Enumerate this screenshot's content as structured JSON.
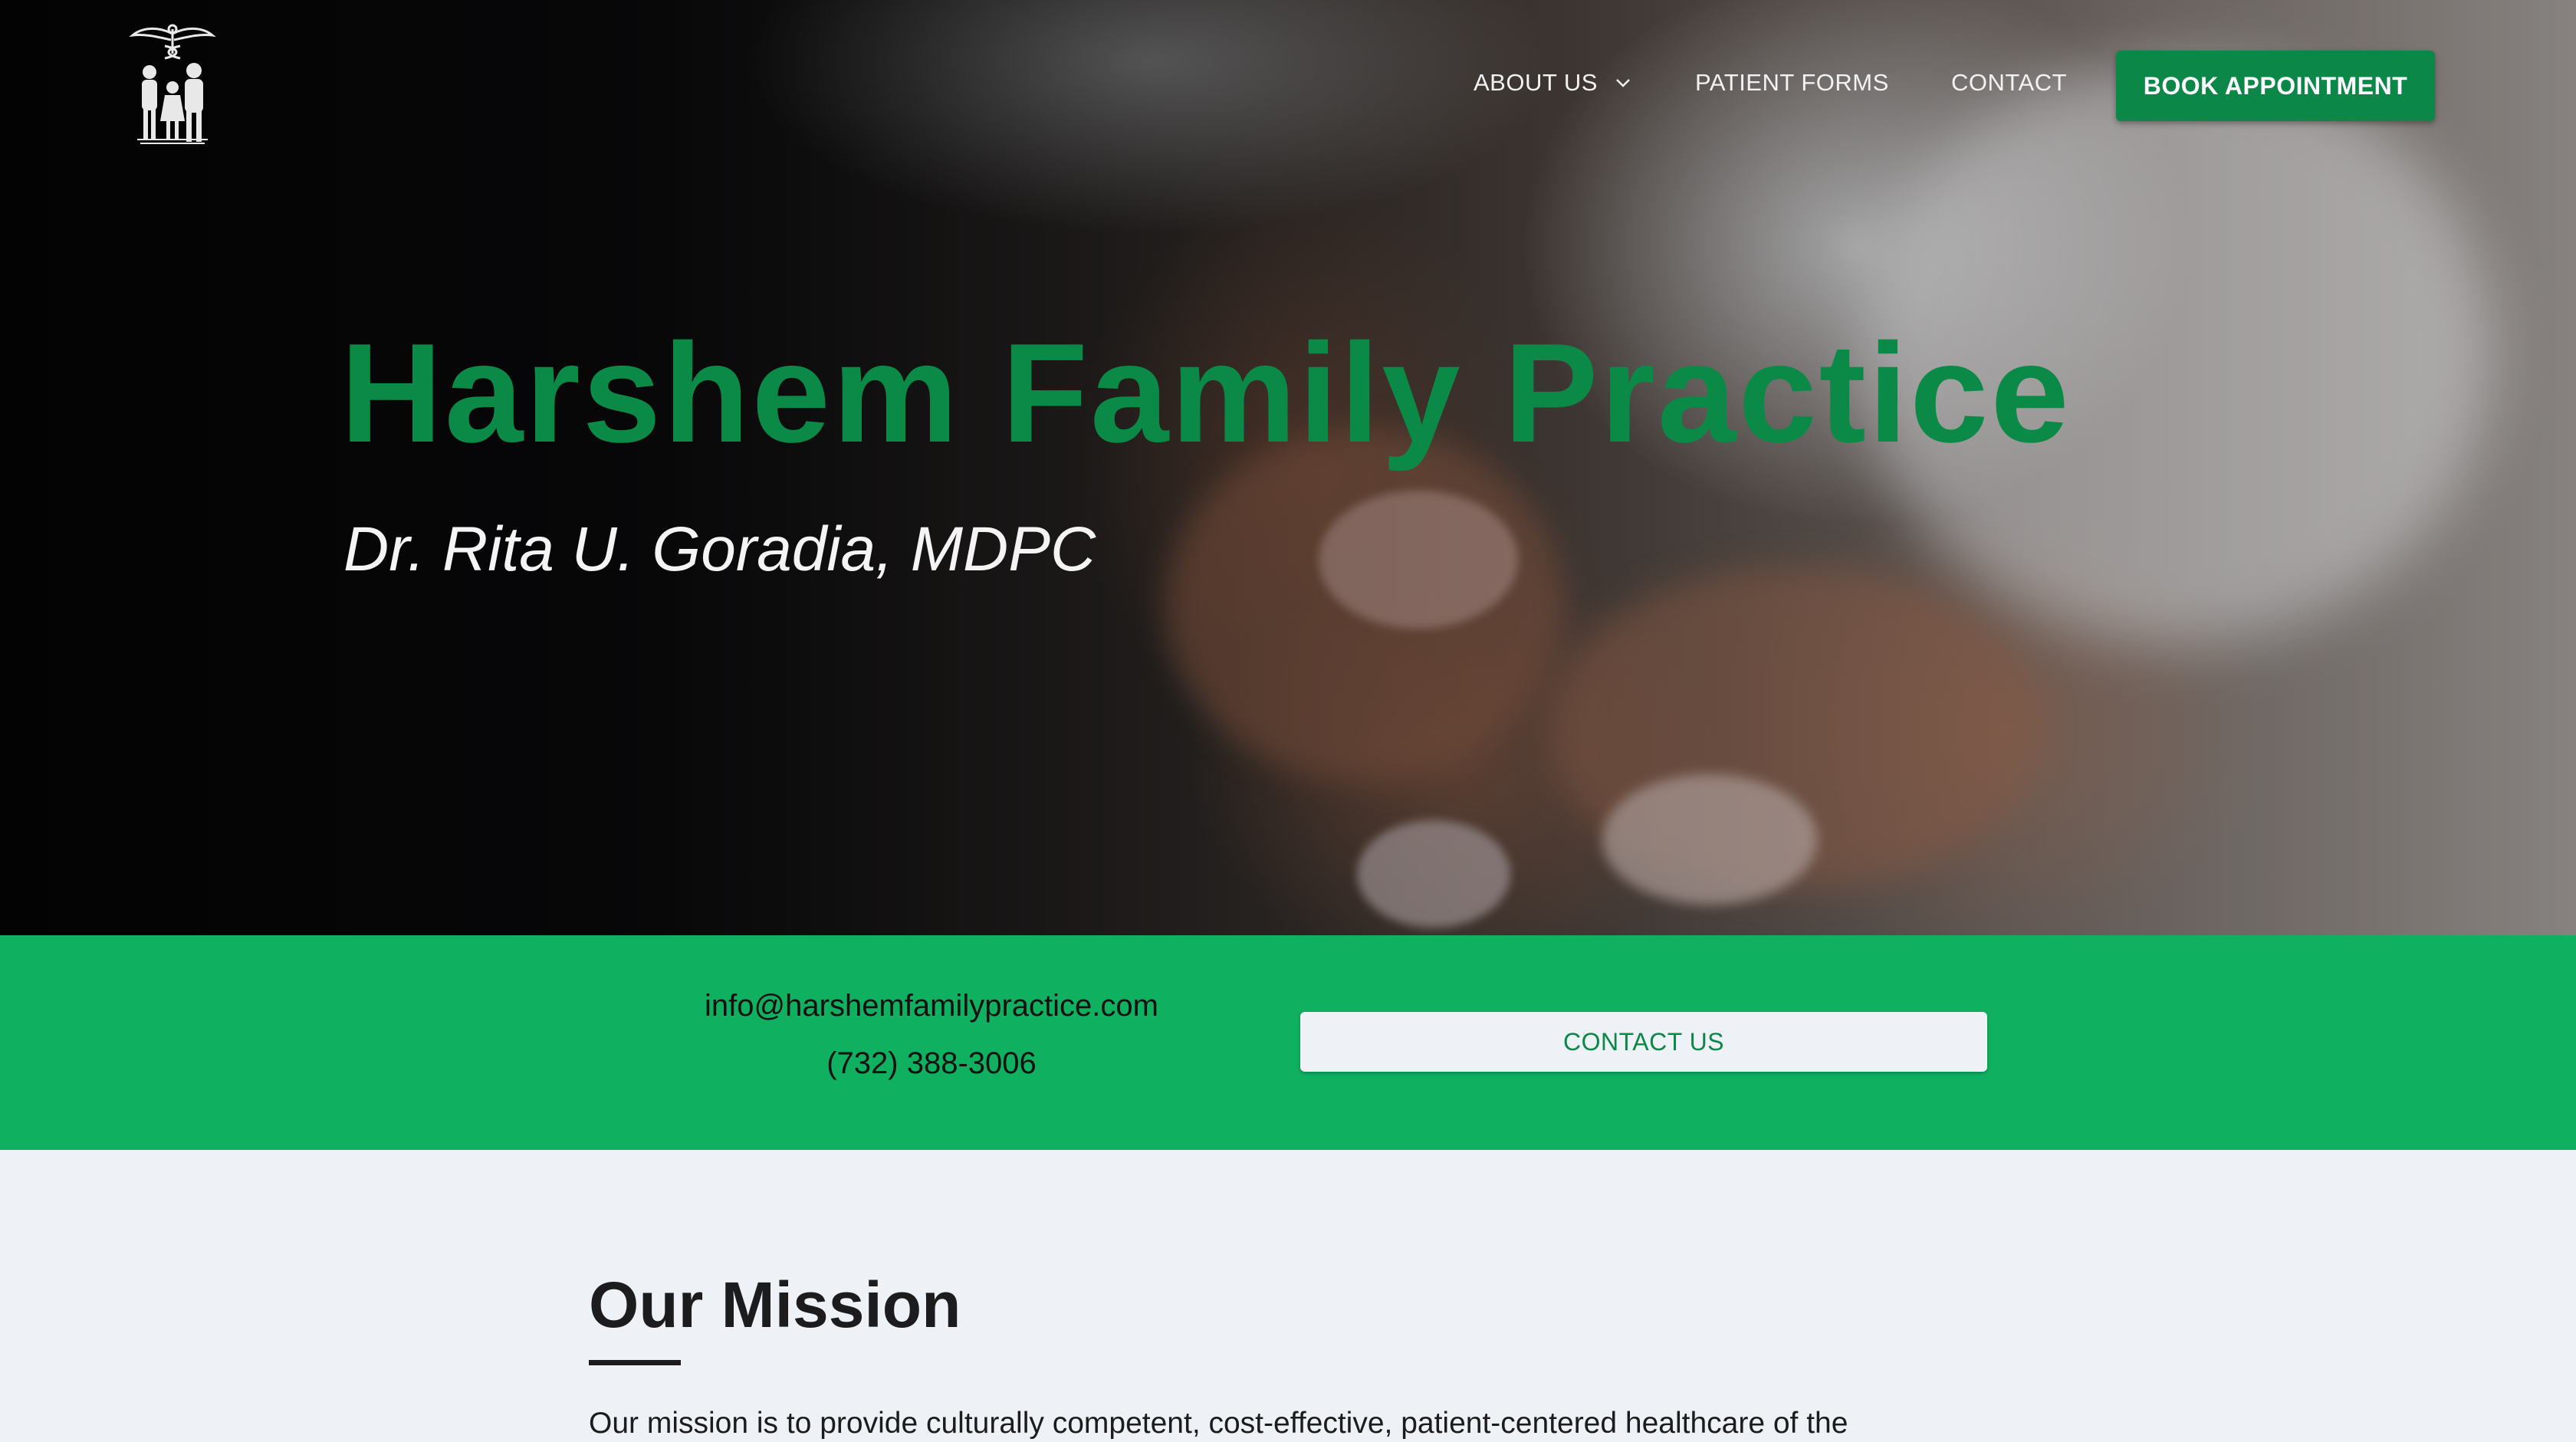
{
  "nav": {
    "logo_icon": "caduceus-family-logo-icon",
    "items": [
      {
        "label": "ABOUT US",
        "has_dropdown": true
      },
      {
        "label": "PATIENT FORMS"
      },
      {
        "label": "CONTACT"
      }
    ],
    "book_label": "BOOK APPOINTMENT"
  },
  "hero": {
    "title": "Harshem Family Practice",
    "subtitle": "Dr. Rita U. Goradia, MDPC"
  },
  "contact_band": {
    "email": "info@harshemfamilypractice.com",
    "phone": "(732) 388-3006",
    "button_label": "CONTACT US"
  },
  "mission": {
    "heading": "Our Mission",
    "text": "Our mission is to provide culturally competent, cost-effective, patient-centered healthcare of the"
  },
  "colors": {
    "brand_green": "#0b8a47",
    "band_green": "#10b061",
    "button_green": "#0b8748",
    "page_bg": "#eef2f6"
  }
}
